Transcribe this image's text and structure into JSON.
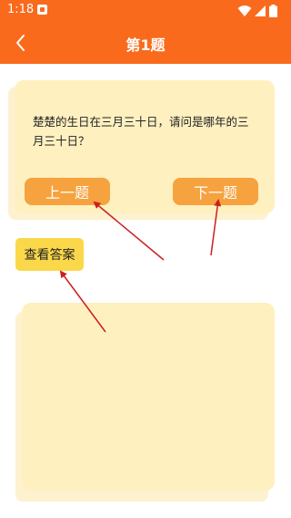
{
  "status_bar": {
    "time": "1:18",
    "icons": [
      "notification-icon",
      "wifi-icon",
      "signal-icon",
      "battery-icon"
    ]
  },
  "app_bar": {
    "back_icon": "chevron-left-icon",
    "title": "第1题"
  },
  "question": {
    "text": "楚楚的生日在三月三十日，请问是哪年的三月三十日？",
    "prev_label": "上一题",
    "next_label": "下一题"
  },
  "answer": {
    "button_label": "查看答案",
    "content": ""
  },
  "colors": {
    "primary": "#f96a1c",
    "card": "#fff0c0",
    "button_orange": "#f6a23e",
    "button_yellow": "#fbd84a",
    "arrow": "#cc1f1f"
  }
}
